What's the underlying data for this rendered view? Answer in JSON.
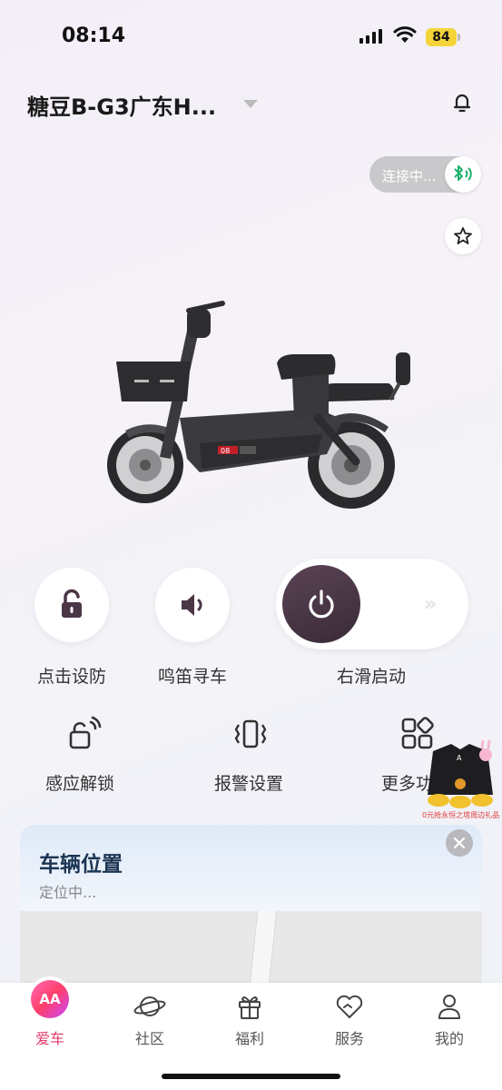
{
  "status_bar": {
    "time": "08:14",
    "battery": "84"
  },
  "header": {
    "title": "糖豆B-G3广东H..."
  },
  "bluetooth": {
    "status": "连接中..."
  },
  "actions": {
    "lock_label": "点击设防",
    "horn_label": "鸣笛寻车",
    "slider_label": "右滑启动",
    "slider_hint": "»"
  },
  "features": {
    "induction_unlock": "感应解锁",
    "alarm_settings": "报警设置",
    "more": "更多功"
  },
  "promo": {
    "text": "0元抢永恒之塔周边礼品"
  },
  "location": {
    "title": "车辆位置",
    "status": "定位中..."
  },
  "tabs": [
    {
      "label": "爱车",
      "icon": "home-brand-icon",
      "active": true
    },
    {
      "label": "社区",
      "icon": "planet-icon"
    },
    {
      "label": "福利",
      "icon": "gift-icon"
    },
    {
      "label": "服务",
      "icon": "heart-icon"
    },
    {
      "label": "我的",
      "icon": "person-icon"
    }
  ],
  "colors": {
    "accent": "#e33a6b",
    "knob": "#4a3646",
    "title": "#1c3554"
  }
}
